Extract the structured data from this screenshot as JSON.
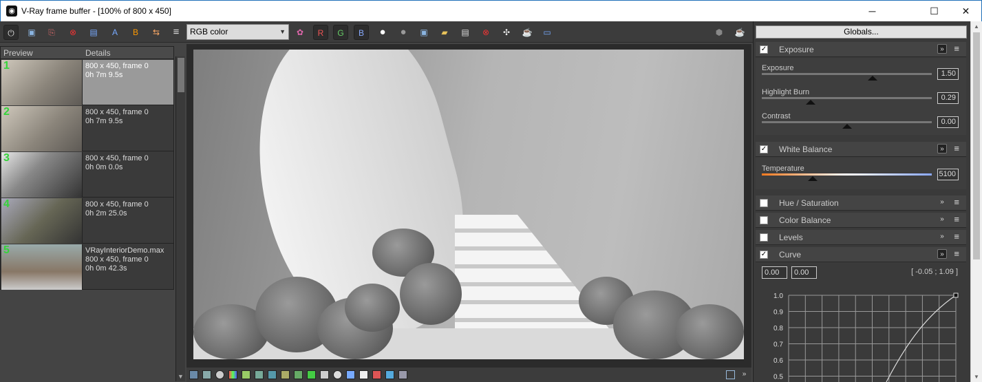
{
  "window": {
    "title": "V-Ray frame buffer - [100% of 800 x 450]",
    "app_icon": "vray-logo-icon",
    "controls": {
      "minimize": "─",
      "maximize": "☐",
      "close": "✕"
    }
  },
  "toolbar": {
    "icons": [
      "power-icon",
      "save-icon",
      "save-all-icon",
      "clear-icon",
      "compare-ab-icon",
      "a-icon",
      "b-icon",
      "ab-swap-icon",
      "menu-icon"
    ],
    "channel_select": "RGB color",
    "channel_buttons": {
      "r": "R",
      "g": "G",
      "b": "B"
    },
    "right_icons": [
      "color-circle-icon",
      "alpha-icon",
      "save-image-icon",
      "open-icon",
      "clipboard-icon",
      "stop-icon",
      "region-icon",
      "teapot-icon",
      "stamp-icon"
    ],
    "far_right_icons": [
      "stop-render-icon",
      "render-teapot-icon"
    ]
  },
  "history": {
    "columns": [
      "Preview",
      "Details"
    ],
    "items": [
      {
        "num": "1",
        "line1": "800 x 450, frame 0",
        "line2": "0h 7m 9.5s",
        "line3": ""
      },
      {
        "num": "2",
        "line1": "800 x 450, frame 0",
        "line2": "0h 7m 9.5s",
        "line3": ""
      },
      {
        "num": "3",
        "line1": "800 x 450, frame 0",
        "line2": "0h 0m 0.0s",
        "line3": ""
      },
      {
        "num": "4",
        "line1": "800 x 450, frame 0",
        "line2": "0h 2m 25.0s",
        "line3": ""
      },
      {
        "num": "5",
        "line1": "VRayInteriorDemo.max",
        "line2": "800 x 450, frame 0",
        "line3": "0h 0m 42.3s"
      }
    ]
  },
  "panel": {
    "globals_label": "Globals...",
    "exposure": {
      "title": "Exposure",
      "params": [
        {
          "label": "Exposure",
          "value": "1.50"
        },
        {
          "label": "Highlight Burn",
          "value": "0.29"
        },
        {
          "label": "Contrast",
          "value": "0.00"
        }
      ]
    },
    "white_balance": {
      "title": "White Balance",
      "params": [
        {
          "label": "Temperature",
          "value": "5100"
        }
      ]
    },
    "hue_saturation": {
      "title": "Hue / Saturation"
    },
    "color_balance": {
      "title": "Color Balance"
    },
    "levels": {
      "title": "Levels"
    },
    "curve": {
      "title": "Curve",
      "x": "0.00",
      "y": "0.00",
      "readout": "[ -0.05 ; 1.09 ]",
      "y_ticks": [
        "1.0",
        "0.9",
        "0.8",
        "0.7",
        "0.6",
        "0.5"
      ]
    }
  },
  "bottombar": {
    "icons": [
      "display-icon",
      "history-icon",
      "info-icon",
      "lut-icon",
      "hsl-icon",
      "levels-icon",
      "histogram-icon",
      "ocio-icon",
      "srgb-icon",
      "color-icon",
      "curve-icon",
      "lens-icon",
      "stamp-icon",
      "h-icon",
      "compare-icon",
      "test-icon",
      "region-icon"
    ],
    "right_icons": [
      "fullscreen-icon",
      "collapse-icon"
    ]
  },
  "colors": {
    "accent": "#1e6fb8",
    "history_number": "#35d33a",
    "panel_bg": "#3a3a3a"
  }
}
